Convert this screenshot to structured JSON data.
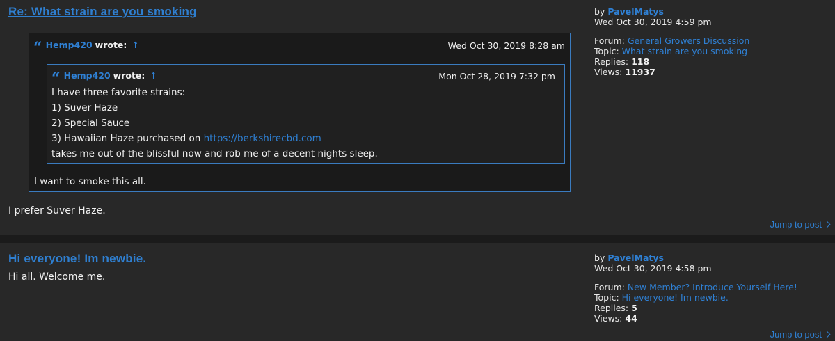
{
  "posts": [
    {
      "title": "Re: What strain are you smoking",
      "quote": {
        "author": "Hemp420",
        "wrote": "wrote:",
        "arrow": "↑",
        "date": "Wed Oct 30, 2019 8:28 am",
        "nested": {
          "author": "Hemp420",
          "wrote": "wrote:",
          "arrow": "↑",
          "date": "Mon Oct 28, 2019 7:32 pm",
          "lines": [
            "I have three favorite strains:",
            "1) Suver Haze",
            "2) Special Sauce",
            "3) Hawaiian Haze purchased on",
            "takes me out of the blissful now and rob me of a decent nights sleep."
          ],
          "link": "https://berkshirecbd.com"
        },
        "text": "I want to smoke this all."
      },
      "body": "I prefer Suver Haze.",
      "meta": {
        "by": "by",
        "author": "PavelMatys",
        "date": "Wed Oct 30, 2019 4:59 pm",
        "forum_label": "Forum:",
        "forum": "General Growers Discussion",
        "topic_label": "Topic:",
        "topic": "What strain are you smoking",
        "replies_label": "Replies:",
        "replies": "118",
        "views_label": "Views:",
        "views": "11937"
      },
      "jump": "Jump to post"
    },
    {
      "title": "Hi everyone! Im newbie.",
      "body": "Hi all. Welcome me.",
      "meta": {
        "by": "by",
        "author": "PavelMatys",
        "date": "Wed Oct 30, 2019 4:58 pm",
        "forum_label": "Forum:",
        "forum": "New Member? Introduce Yourself Here!",
        "topic_label": "Topic:",
        "topic": "Hi everyone! Im newbie.",
        "replies_label": "Replies:",
        "replies": "5",
        "views_label": "Views:",
        "views": "44"
      },
      "jump": "Jump to post"
    }
  ],
  "colors": {
    "background": "#282828",
    "link": "#2f7fd0",
    "quote_border": "#3a7bbf",
    "text": "#f0f0f0"
  }
}
